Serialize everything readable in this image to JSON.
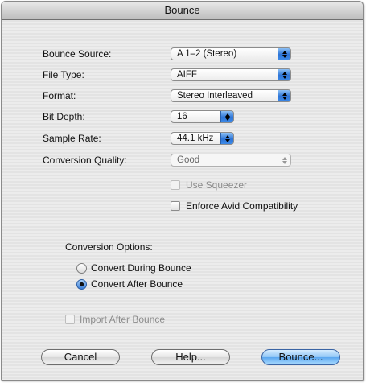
{
  "window": {
    "title": "Bounce"
  },
  "fields": {
    "bounce_source": {
      "label": "Bounce Source:",
      "value": "A 1–2 (Stereo)"
    },
    "file_type": {
      "label": "File Type:",
      "value": "AIFF"
    },
    "format": {
      "label": "Format:",
      "value": "Stereo Interleaved"
    },
    "bit_depth": {
      "label": "Bit Depth:",
      "value": "16"
    },
    "sample_rate": {
      "label": "Sample Rate:",
      "value": "44.1 kHz"
    },
    "conversion_quality": {
      "label": "Conversion Quality:",
      "value": "Good",
      "enabled": false
    }
  },
  "checkboxes": {
    "use_squeezer": {
      "label": "Use Squeezer",
      "checked": false,
      "enabled": false
    },
    "enforce_avid": {
      "label": "Enforce Avid Compatibility",
      "checked": false,
      "enabled": true
    },
    "import_after_bounce": {
      "label": "Import After Bounce",
      "checked": false,
      "enabled": false
    }
  },
  "conversion_options": {
    "heading": "Conversion Options:",
    "options": [
      {
        "label": "Convert During Bounce",
        "selected": false
      },
      {
        "label": "Convert After Bounce",
        "selected": true
      }
    ]
  },
  "buttons": {
    "cancel": "Cancel",
    "help": "Help...",
    "bounce": "Bounce..."
  }
}
